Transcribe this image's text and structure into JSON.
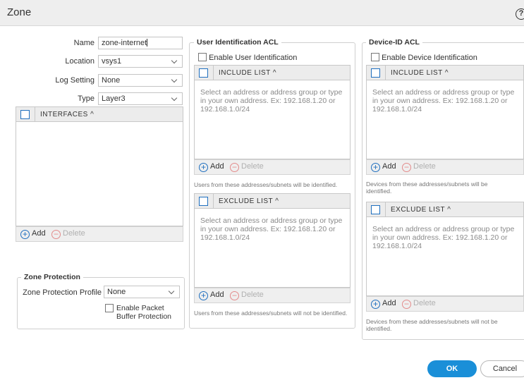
{
  "dialog": {
    "title": "Zone",
    "help_icon": "question-icon"
  },
  "general": {
    "name_label": "Name",
    "name_value": "zone-internet",
    "location_label": "Location",
    "location_value": "vsys1",
    "log_label": "Log Setting",
    "log_value": "None",
    "type_label": "Type",
    "type_value": "Layer3"
  },
  "interfaces": {
    "header": "INTERFACES",
    "add_label": "Add",
    "delete_label": "Delete"
  },
  "zone_protection": {
    "legend": "Zone Protection",
    "profile_label": "Zone Protection Profile",
    "profile_value": "None",
    "packet_buffer_label_1": "Enable Packet",
    "packet_buffer_label_2": "Buffer Protection"
  },
  "user_acl": {
    "legend": "User Identification ACL",
    "enable_label": "Enable User Identification",
    "include_header": "INCLUDE LIST",
    "include_hint": "Select an address or address group or type in your own address. Ex: 192.168.1.20 or 192.168.1.0/24",
    "include_note": "Users from these addresses/subnets will be identified.",
    "exclude_header": "EXCLUDE LIST",
    "exclude_hint": "Select an address or address group or type in your own address. Ex: 192.168.1.20 or 192.168.1.0/24",
    "exclude_note": "Users from these addresses/subnets will not be identified.",
    "add_label": "Add",
    "delete_label": "Delete"
  },
  "device_acl": {
    "legend": "Device-ID ACL",
    "enable_label": "Enable Device Identification",
    "include_header": "INCLUDE LIST",
    "include_hint": "Select an address or address group or type in your own address. Ex: 192.168.1.20 or 192.168.1.0/24",
    "include_note": "Devices from these addresses/subnets will be identified.",
    "exclude_header": "EXCLUDE LIST",
    "exclude_hint": "Select an address or address group or type in your own address. Ex: 192.168.1.20 or 192.168.1.0/24",
    "exclude_note": "Devices from these addresses/subnets will not be identified.",
    "add_label": "Add",
    "delete_label": "Delete"
  },
  "footer": {
    "ok_label": "OK",
    "cancel_label": "Cancel",
    "accent": "#1a8fd8"
  }
}
